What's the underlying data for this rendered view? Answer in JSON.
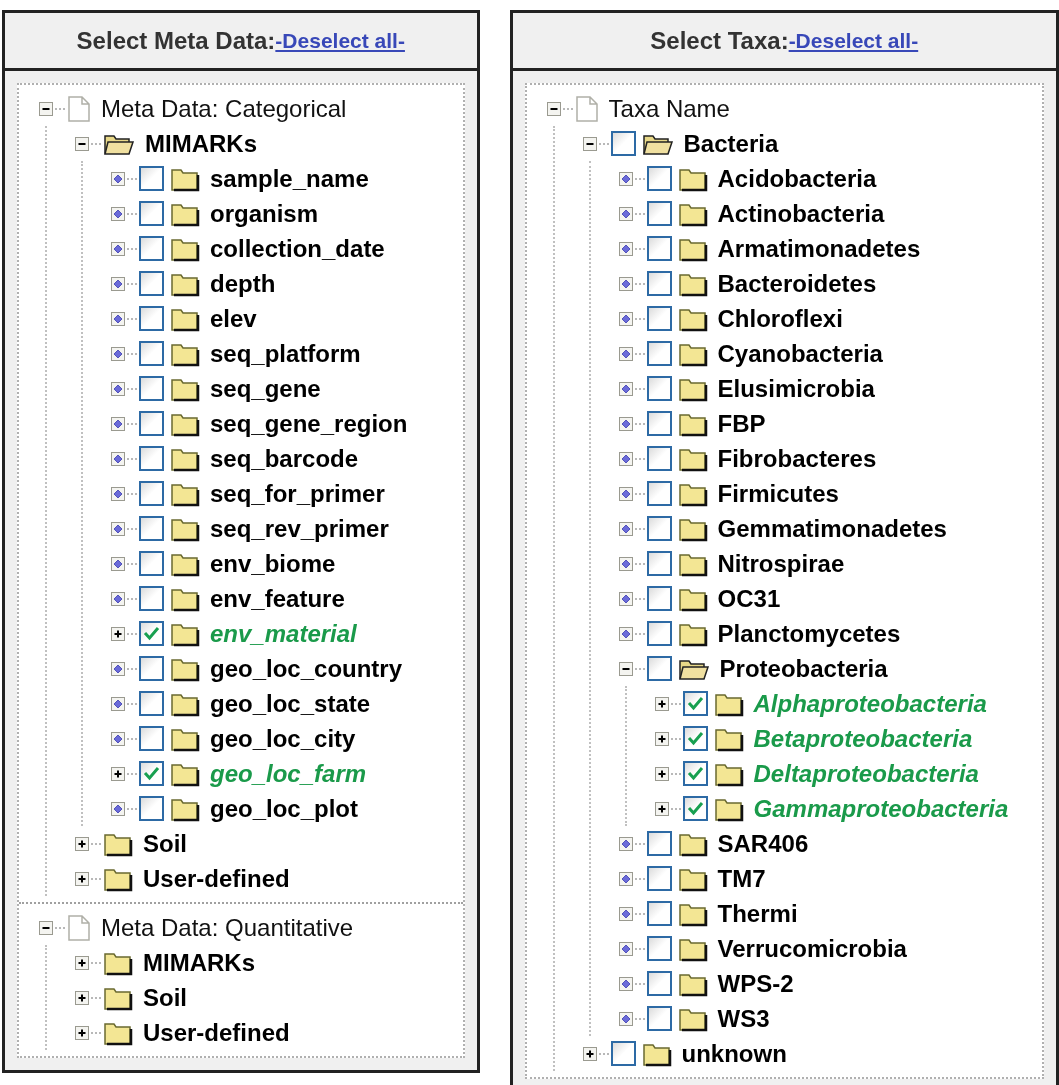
{
  "meta_panel": {
    "title": "Select Meta Data:",
    "deselect_link": "-Deselect all-",
    "trees": [
      {
        "label": "Meta Data: Categorical",
        "kind": "root",
        "expanded": true,
        "children": [
          {
            "label": "MIMARKs",
            "kind": "folder",
            "expanded": true,
            "children": [
              {
                "label": "sample_name",
                "kind": "leaf",
                "checked": false
              },
              {
                "label": "organism",
                "kind": "leaf",
                "checked": false
              },
              {
                "label": "collection_date",
                "kind": "leaf",
                "checked": false
              },
              {
                "label": "depth",
                "kind": "leaf",
                "checked": false
              },
              {
                "label": "elev",
                "kind": "leaf",
                "checked": false
              },
              {
                "label": "seq_platform",
                "kind": "leaf",
                "checked": false
              },
              {
                "label": "seq_gene",
                "kind": "leaf",
                "checked": false
              },
              {
                "label": "seq_gene_region",
                "kind": "leaf",
                "checked": false
              },
              {
                "label": "seq_barcode",
                "kind": "leaf",
                "checked": false
              },
              {
                "label": "seq_for_primer",
                "kind": "leaf",
                "checked": false
              },
              {
                "label": "seq_rev_primer",
                "kind": "leaf",
                "checked": false
              },
              {
                "label": "env_biome",
                "kind": "leaf",
                "checked": false
              },
              {
                "label": "env_feature",
                "kind": "leaf",
                "checked": false
              },
              {
                "label": "env_material",
                "kind": "check_folder",
                "expanded": false,
                "checked": true
              },
              {
                "label": "geo_loc_country",
                "kind": "leaf",
                "checked": false
              },
              {
                "label": "geo_loc_state",
                "kind": "leaf",
                "checked": false
              },
              {
                "label": "geo_loc_city",
                "kind": "leaf",
                "checked": false
              },
              {
                "label": "geo_loc_farm",
                "kind": "check_folder",
                "expanded": false,
                "checked": true
              },
              {
                "label": "geo_loc_plot",
                "kind": "leaf",
                "checked": false
              }
            ]
          },
          {
            "label": "Soil",
            "kind": "folder",
            "expanded": false
          },
          {
            "label": "User-defined",
            "kind": "folder",
            "expanded": false
          }
        ]
      },
      {
        "label": "Meta Data: Quantitative",
        "kind": "root",
        "expanded": true,
        "children": [
          {
            "label": "MIMARKs",
            "kind": "folder",
            "expanded": false
          },
          {
            "label": "Soil",
            "kind": "folder",
            "expanded": false
          },
          {
            "label": "User-defined",
            "kind": "folder",
            "expanded": false
          }
        ]
      }
    ]
  },
  "taxa_panel": {
    "title": "Select Taxa:",
    "deselect_link": "-Deselect all-",
    "trees": [
      {
        "label": "Taxa Name",
        "kind": "root",
        "expanded": true,
        "children": [
          {
            "label": "Bacteria",
            "kind": "check_folder",
            "expanded": true,
            "checked": false,
            "children": [
              {
                "label": "Acidobacteria",
                "kind": "leaf",
                "checked": false
              },
              {
                "label": "Actinobacteria",
                "kind": "leaf",
                "checked": false
              },
              {
                "label": "Armatimonadetes",
                "kind": "leaf",
                "checked": false
              },
              {
                "label": "Bacteroidetes",
                "kind": "leaf",
                "checked": false
              },
              {
                "label": "Chloroflexi",
                "kind": "leaf",
                "checked": false
              },
              {
                "label": "Cyanobacteria",
                "kind": "leaf",
                "checked": false
              },
              {
                "label": "Elusimicrobia",
                "kind": "leaf",
                "checked": false
              },
              {
                "label": "FBP",
                "kind": "leaf",
                "checked": false
              },
              {
                "label": "Fibrobacteres",
                "kind": "leaf",
                "checked": false
              },
              {
                "label": "Firmicutes",
                "kind": "leaf",
                "checked": false
              },
              {
                "label": "Gemmatimonadetes",
                "kind": "leaf",
                "checked": false
              },
              {
                "label": "Nitrospirae",
                "kind": "leaf",
                "checked": false
              },
              {
                "label": "OC31",
                "kind": "leaf",
                "checked": false
              },
              {
                "label": "Planctomycetes",
                "kind": "leaf",
                "checked": false
              },
              {
                "label": "Proteobacteria",
                "kind": "check_folder",
                "expanded": true,
                "checked": false,
                "children": [
                  {
                    "label": "Alphaproteobacteria",
                    "kind": "check_folder",
                    "expanded": false,
                    "checked": true
                  },
                  {
                    "label": "Betaproteobacteria",
                    "kind": "check_folder",
                    "expanded": false,
                    "checked": true
                  },
                  {
                    "label": "Deltaproteobacteria",
                    "kind": "check_folder",
                    "expanded": false,
                    "checked": true
                  },
                  {
                    "label": "Gammaproteobacteria",
                    "kind": "check_folder",
                    "expanded": false,
                    "checked": true
                  }
                ]
              },
              {
                "label": "SAR406",
                "kind": "leaf",
                "checked": false
              },
              {
                "label": "TM7",
                "kind": "leaf",
                "checked": false
              },
              {
                "label": "Thermi",
                "kind": "leaf",
                "checked": false
              },
              {
                "label": "Verrucomicrobia",
                "kind": "leaf",
                "checked": false
              },
              {
                "label": "WPS-2",
                "kind": "leaf",
                "checked": false
              },
              {
                "label": "WS3",
                "kind": "leaf",
                "checked": false
              }
            ]
          },
          {
            "label": "unknown",
            "kind": "check_folder",
            "expanded": false,
            "checked": false
          }
        ]
      }
    ]
  }
}
